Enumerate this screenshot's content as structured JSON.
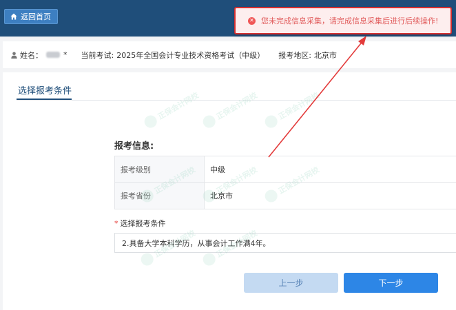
{
  "header": {
    "home_label": "返回首页"
  },
  "toast": {
    "message": "您未完成信息采集，请完成信息采集后进行后续操作!",
    "icon": "error-circle-icon",
    "color": "#e15c5c",
    "border_color": "#d32f2f"
  },
  "infobar": {
    "name_label": "姓名：",
    "name_suffix": "*",
    "exam_label": "当前考试:",
    "exam_value": "2025年全国会计专业技术资格考试（中级）",
    "region_label": "报考地区:",
    "region_value": "北京市"
  },
  "tabs": [
    {
      "label": "选择报考条件",
      "active": true
    }
  ],
  "section": {
    "title": "报考信息:",
    "rows": [
      {
        "label": "报考级别",
        "value": "中级"
      },
      {
        "label": "报考省份",
        "value": "北京市"
      }
    ]
  },
  "condition": {
    "required_mark": "*",
    "label": "选择报考条件",
    "selected": "2.具备大学本科学历，从事会计工作满4年。"
  },
  "buttons": {
    "prev": "上一步",
    "next": "下一步"
  },
  "colors": {
    "header_bg": "#1f4e7a",
    "primary": "#2d86e6",
    "primary_light": "#c4daf2"
  }
}
